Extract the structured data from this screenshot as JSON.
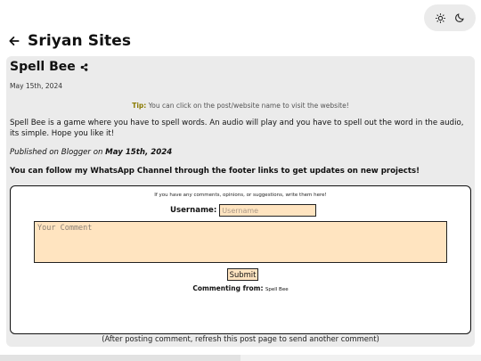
{
  "header": {
    "title": "Sriyan Sites",
    "back_icon": "arrow-left-icon",
    "theme_icons": [
      "sun-icon",
      "moon-icon"
    ]
  },
  "post": {
    "title": "Spell Bee",
    "share_icon": "share-icon",
    "date": "May 15th, 2024",
    "tip_label": "Tip:",
    "tip_text": "You can click on the post/website name to visit the website!",
    "description": "Spell Bee is a game where you have to spell words. An audio will play and you have to spell out the word in the audio, its simple. Hope you like it!",
    "published_prefix": "Published on Blogger on",
    "published_date": "May 15th, 2024",
    "follow_text": "You can follow my WhatsApp Channel through the footer links to get updates on new projects!"
  },
  "comment_form": {
    "hint": "If you have any comments, opinions, or suggestions, write them here!",
    "username_label": "Username:",
    "username_placeholder": "Username",
    "comment_placeholder": "Your Comment",
    "submit_label": "Submit",
    "from_label": "Commenting from:",
    "from_value": "Spell Bee"
  },
  "after_note": "(After posting comment, refresh this post page to send another comment)",
  "colors": {
    "card_bg": "#ebebeb",
    "input_bg": "#ffe4c0",
    "tip_accent": "#8a7a00"
  }
}
